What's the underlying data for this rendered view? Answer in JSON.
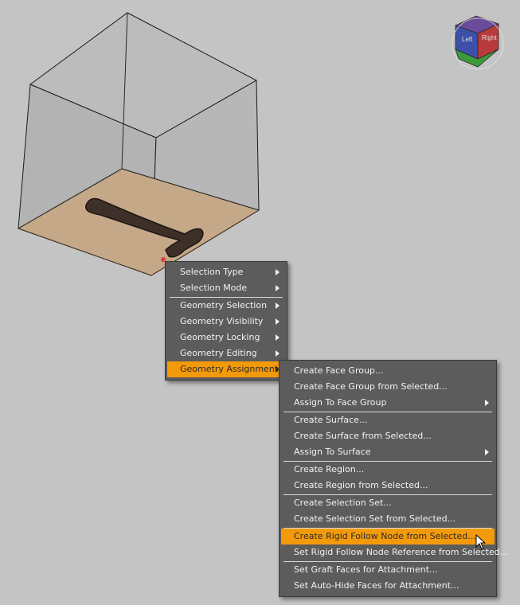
{
  "context_menu": {
    "items": [
      {
        "label": "Selection Type",
        "submenu": true
      },
      {
        "label": "Selection Mode",
        "submenu": true
      },
      {
        "label": "Geometry Selection",
        "submenu": true
      },
      {
        "label": "Geometry Visibility",
        "submenu": true
      },
      {
        "label": "Geometry Locking",
        "submenu": true
      },
      {
        "label": "Geometry Editing",
        "submenu": true
      },
      {
        "label": "Geometry Assignment",
        "submenu": true,
        "highlighted": true
      }
    ]
  },
  "submenu": {
    "items": [
      {
        "label": "Create Face Group..."
      },
      {
        "label": "Create Face Group from Selected..."
      },
      {
        "label": "Assign To Face Group",
        "submenu": true
      },
      {
        "label": "Create Surface..."
      },
      {
        "label": "Create Surface from Selected..."
      },
      {
        "label": "Assign To Surface",
        "submenu": true
      },
      {
        "label": "Create Region..."
      },
      {
        "label": "Create Region from Selected..."
      },
      {
        "label": "Create Selection Set..."
      },
      {
        "label": "Create Selection Set from Selected..."
      },
      {
        "label": "Create Rigid Follow Node from Selected...",
        "highlighted": true
      },
      {
        "label": "Set Rigid Follow Node Reference from Selected..."
      },
      {
        "label": "Set Graft Faces for Attachment..."
      },
      {
        "label": "Set Auto-Hide Faces for Attachment..."
      }
    ]
  },
  "view_cube": {
    "left_face": "Left",
    "right_face": "Right"
  },
  "colors": {
    "background": "#c4c4c4",
    "menu_bg": "#5c5c5c",
    "highlight": "#f39a0b",
    "floor": "#c4a888"
  },
  "icons": [
    "view-cube-icon",
    "submenu-arrow-icon",
    "mouse-cursor-icon"
  ]
}
